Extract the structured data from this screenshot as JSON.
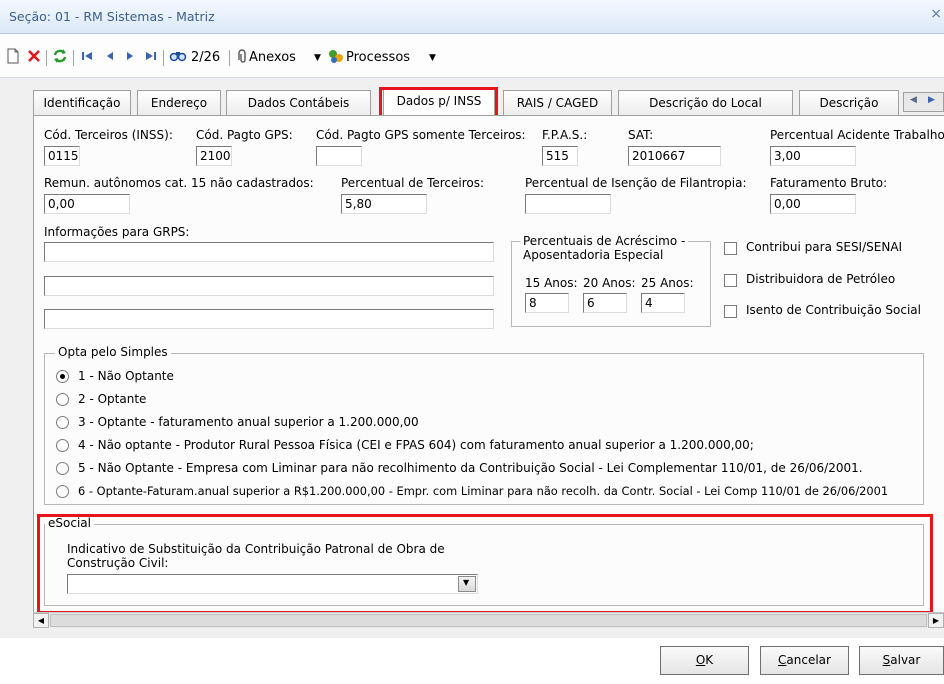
{
  "window": {
    "title": "Seção: 01 - RM Sistemas - Matriz",
    "close_glyph": "×"
  },
  "toolbar": {
    "record_position": "2/26",
    "attachments_label": "Anexos",
    "processes_label": "Processos",
    "icons": [
      "new-icon",
      "delete-icon",
      "refresh-icon",
      "first-record-icon",
      "prev-record-icon",
      "next-record-icon",
      "last-record-icon",
      "find-icon",
      "attachments-icon",
      "processes-icon"
    ]
  },
  "tabs": [
    {
      "label": "Identificação",
      "active": false
    },
    {
      "label": "Endereço",
      "active": false
    },
    {
      "label": "Dados Contábeis",
      "active": false
    },
    {
      "label": "Dados p/ INSS",
      "active": true
    },
    {
      "label": "RAIS / CAGED",
      "active": false
    },
    {
      "label": "Descrição do Local",
      "active": false
    },
    {
      "label": "Descrição",
      "active": false
    }
  ],
  "fields": {
    "cod_terceiros": {
      "label": "Cód. Terceiros (INSS):",
      "value": "0115"
    },
    "cod_pagto_gps": {
      "label": "Cód. Pagto GPS:",
      "value": "2100"
    },
    "cod_pagto_gps_terceiros": {
      "label": "Cód. Pagto GPS somente Terceiros:",
      "value": ""
    },
    "fpas": {
      "label": "F.P.A.S.:",
      "value": "515"
    },
    "sat": {
      "label": "SAT:",
      "value": "2010667"
    },
    "perc_acidente": {
      "label": "Percentual Acidente Trabalho:",
      "value": "3,00"
    },
    "remun_autonomos": {
      "label": "Remun. autônomos cat. 15 não cadastrados:",
      "value": "0,00"
    },
    "perc_terceiros": {
      "label": "Percentual de Terceiros:",
      "value": "5,80"
    },
    "perc_isencao": {
      "label": "Percentual de Isenção de Filantropia:",
      "value": ""
    },
    "faturamento_bruto": {
      "label": "Faturamento Bruto:",
      "value": "0,00"
    }
  },
  "grps": {
    "label": "Informações para GRPS:",
    "lines": [
      "",
      "",
      ""
    ]
  },
  "aposentadoria": {
    "title_line1": "Percentuais de Acréscimo -",
    "title_line2": "Aposentadoria Especial",
    "cols": [
      {
        "label": "15 Anos:",
        "value": "8"
      },
      {
        "label": "20 Anos:",
        "value": "6"
      },
      {
        "label": "25 Anos:",
        "value": "4"
      }
    ]
  },
  "checkboxes": [
    {
      "label": "Contribui para SESI/SENAI",
      "checked": false
    },
    {
      "label": "Distribuidora de Petróleo",
      "checked": false
    },
    {
      "label": "Isento de Contribuição Social",
      "checked": false
    }
  ],
  "simples": {
    "title": "Opta pelo Simples",
    "options": [
      {
        "label": "1 - Não Optante",
        "selected": true
      },
      {
        "label": "2 - Optante",
        "selected": false
      },
      {
        "label": "3 - Optante - faturamento anual superior a 1.200.000,00",
        "selected": false
      },
      {
        "label": "4 - Não optante - Produtor Rural Pessoa Física (CEI e FPAS 604)  com faturamento anual superior a 1.200.000,00;",
        "selected": false
      },
      {
        "label": "5 - Não Optante - Empresa com Liminar para não recolhimento da Contribuição Social - Lei Complementar 110/01, de 26/06/2001.",
        "selected": false
      },
      {
        "label": "6 - Optante-Faturam.anual superior a R$1.200.000,00 - Empr. com Liminar para não recolh. da Contr. Social - Lei Comp 110/01 de 26/06/2001",
        "selected": false
      }
    ]
  },
  "esocial": {
    "title": "eSocial",
    "field_label_line1": "Indicativo de Substituição da Contribuição Patronal de Obra de",
    "field_label_line2": "Construção Civil:",
    "value": ""
  },
  "buttons": {
    "ok": {
      "accel": "O",
      "rest": "K"
    },
    "cancel": {
      "accel": "C",
      "rest": "ancelar"
    },
    "save": {
      "accel": "S",
      "rest": "alvar"
    }
  },
  "colors": {
    "highlight": "#e8141c",
    "title_text": "#3d5f8c"
  }
}
